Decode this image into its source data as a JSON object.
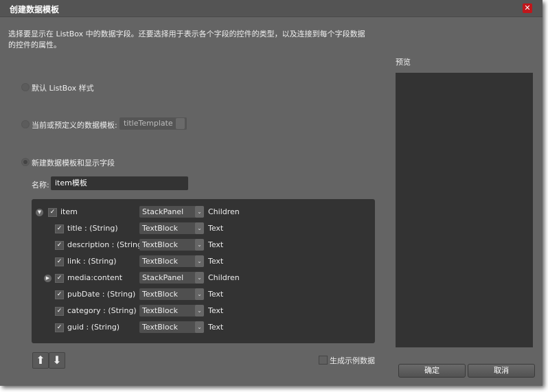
{
  "dialog": {
    "title": "创建数据模板",
    "description": "选择要显示在 ListBox 中的数据字段。还要选择用于表示各个字段的控件的类型，以及连接到每个字段数据的控件的属性。"
  },
  "options": {
    "default_style": "默认 ListBox 样式",
    "existing_template": "当前或预定义的数据模板:",
    "existing_template_value": "titleTemplate",
    "new_template": "新建数据模板和显示字段",
    "selected": "new_template"
  },
  "name_field": {
    "label": "名称:",
    "value": "item模板"
  },
  "tree": [
    {
      "label": "item",
      "checked": true,
      "expander": "expanded",
      "control": "StackPanel",
      "property": "Children",
      "indent": 0
    },
    {
      "label": "title : (String)",
      "checked": true,
      "control": "TextBlock",
      "property": "Text",
      "indent": 1
    },
    {
      "label": "description : (String)",
      "checked": true,
      "control": "TextBlock",
      "property": "Text",
      "indent": 1
    },
    {
      "label": "link : (String)",
      "checked": true,
      "control": "TextBlock",
      "property": "Text",
      "indent": 1
    },
    {
      "label": "media:content",
      "checked": true,
      "expander": "collapsed",
      "control": "StackPanel",
      "property": "Children",
      "indent": 1
    },
    {
      "label": "pubDate : (String)",
      "checked": true,
      "control": "TextBlock",
      "property": "Text",
      "indent": 1
    },
    {
      "label": "category : (String)",
      "checked": true,
      "control": "TextBlock",
      "property": "Text",
      "indent": 1
    },
    {
      "label": "guid : (String)",
      "checked": true,
      "control": "TextBlock",
      "property": "Text",
      "indent": 1
    }
  ],
  "sample_data": {
    "label": "生成示例数据",
    "checked": false
  },
  "preview": {
    "label": "预览"
  },
  "buttons": {
    "ok": "确定",
    "cancel": "取消"
  },
  "colors": {
    "close": "#c0161b",
    "background": "#646464",
    "panel": "#333333"
  }
}
